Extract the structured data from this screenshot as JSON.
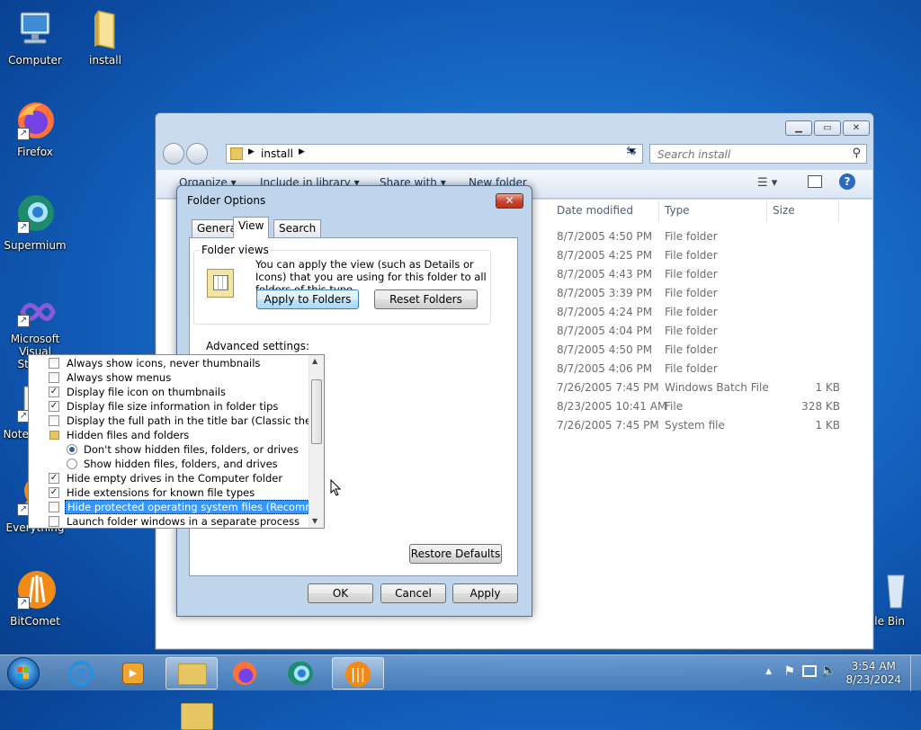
{
  "desktop": {
    "icons": [
      {
        "label": "Computer"
      },
      {
        "label": "install"
      },
      {
        "label": "Firefox"
      },
      {
        "label": "Supermium"
      },
      {
        "label": "Microsoft Visual Stud..."
      },
      {
        "label": "Notepad++"
      },
      {
        "label": "Everything"
      },
      {
        "label": "BitComet"
      },
      {
        "label": "cle Bin"
      }
    ]
  },
  "explorer": {
    "address_folder": "install",
    "search_placeholder": "Search install",
    "toolbar": {
      "organize": "Organize",
      "include": "Include in library",
      "share": "Share with",
      "new_folder": "New folder"
    },
    "columns": {
      "date": "Date modified",
      "type": "Type",
      "size": "Size"
    },
    "files": [
      {
        "date": "8/7/2005 4:50 PM",
        "type": "File folder",
        "size": ""
      },
      {
        "date": "8/7/2005 4:25 PM",
        "type": "File folder",
        "size": ""
      },
      {
        "date": "8/7/2005 4:43 PM",
        "type": "File folder",
        "size": ""
      },
      {
        "date": "8/7/2005 3:39 PM",
        "type": "File folder",
        "size": ""
      },
      {
        "date": "8/7/2005 4:24 PM",
        "type": "File folder",
        "size": ""
      },
      {
        "date": "8/7/2005 4:04 PM",
        "type": "File folder",
        "size": ""
      },
      {
        "date": "8/7/2005 4:50 PM",
        "type": "File folder",
        "size": ""
      },
      {
        "date": "8/7/2005 4:06 PM",
        "type": "File folder",
        "size": ""
      },
      {
        "date": "7/26/2005 7:45 PM",
        "type": "Windows Batch File",
        "size": "1 KB"
      },
      {
        "date": "8/23/2005 10:41 AM",
        "type": "File",
        "size": "328 KB"
      },
      {
        "date": "7/26/2005 7:45 PM",
        "type": "System file",
        "size": "1 KB"
      }
    ]
  },
  "dialog": {
    "title": "Folder Options",
    "tabs": [
      "General",
      "View",
      "Search"
    ],
    "folder_views": {
      "legend": "Folder views",
      "description": "You can apply the view (such as Details or Icons) that you are using for this folder to all folders of this type.",
      "apply_button": "Apply to Folders",
      "reset_button": "Reset Folders"
    },
    "advanced_label": "Advanced settings:",
    "settings": [
      {
        "kind": "checkbox",
        "checked": false,
        "label": "Always show icons, never thumbnails"
      },
      {
        "kind": "checkbox",
        "checked": false,
        "label": "Always show menus"
      },
      {
        "kind": "checkbox",
        "checked": true,
        "label": "Display file icon on thumbnails"
      },
      {
        "kind": "checkbox",
        "checked": true,
        "label": "Display file size information in folder tips"
      },
      {
        "kind": "checkbox",
        "checked": false,
        "label": "Display the full path in the title bar (Classic theme only)"
      },
      {
        "kind": "folder",
        "label": "Hidden files and folders"
      },
      {
        "kind": "radio",
        "checked": true,
        "label": "Don't show hidden files, folders, or drives"
      },
      {
        "kind": "radio",
        "checked": false,
        "label": "Show hidden files, folders, and drives"
      },
      {
        "kind": "checkbox",
        "checked": true,
        "label": "Hide empty drives in the Computer folder"
      },
      {
        "kind": "checkbox",
        "checked": true,
        "label": "Hide extensions for known file types"
      },
      {
        "kind": "checkbox",
        "checked": false,
        "label": "Hide protected operating system files (Recommended)",
        "selected": true
      },
      {
        "kind": "checkbox",
        "checked": false,
        "label": "Launch folder windows in a separate process"
      }
    ],
    "restore_button": "Restore Defaults",
    "ok_button": "OK",
    "cancel_button": "Cancel",
    "apply_button": "Apply"
  },
  "taskbar": {
    "time": "3:54 AM",
    "date": "8/23/2024"
  }
}
